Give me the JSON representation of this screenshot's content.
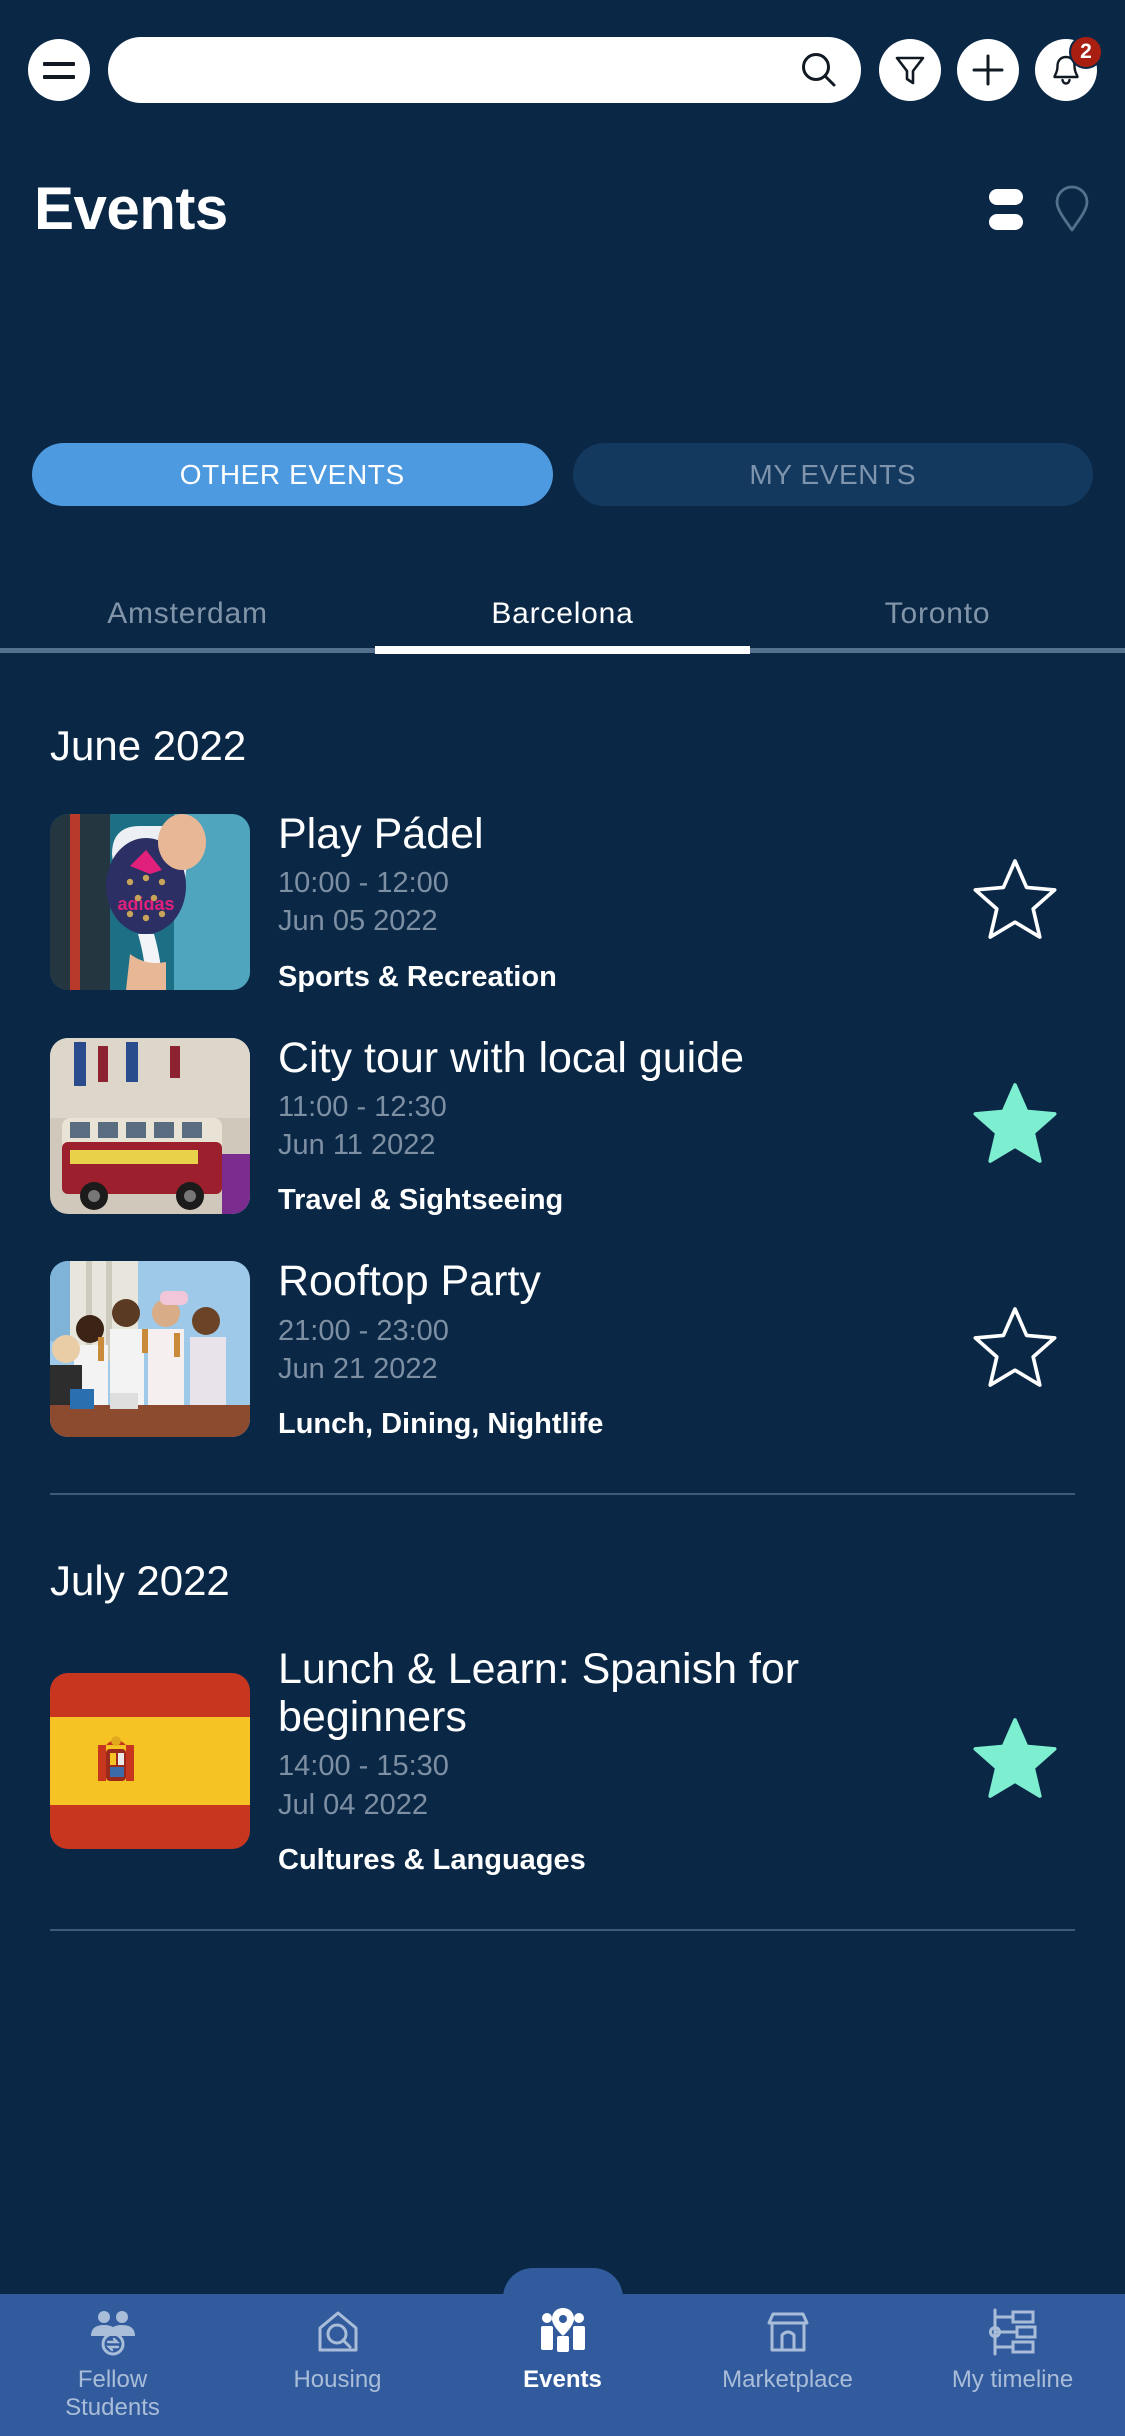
{
  "theme": {
    "background": "#0a2846",
    "accent_blue": "#4d9ae0",
    "nav_bar": "#325b9e",
    "star_filled": "#7eeed0",
    "badge_red": "#a81f12",
    "muted_text": "#7d8fa3"
  },
  "topbar": {
    "menu_label": "Menu",
    "search_placeholder": "",
    "search_value": "",
    "search_icon": "search-icon",
    "filter_icon": "filter-funnel-icon",
    "add_icon": "plus-icon",
    "notification_icon": "bell-icon",
    "notification_count": "2"
  },
  "header": {
    "title": "Events",
    "list_view_icon": "list-view-icon",
    "map_view_icon": "map-pin-icon"
  },
  "segments": [
    {
      "label": "OTHER EVENTS",
      "active": true
    },
    {
      "label": "MY EVENTS",
      "active": false
    }
  ],
  "city_tabs": [
    {
      "label": "Amsterdam",
      "active": false
    },
    {
      "label": "Barcelona",
      "active": true
    },
    {
      "label": "Toronto",
      "active": false
    }
  ],
  "sections": [
    {
      "month": "June 2022",
      "events": [
        {
          "title": "Play Pádel",
          "time": "10:00 - 12:00",
          "date": "Jun 05 2022",
          "category": "Sports & Recreation",
          "thumbnail": "padel-racket-photo",
          "favorited": false
        },
        {
          "title": "City tour with local guide",
          "time": "11:00 - 12:30",
          "date": "Jun 11 2022",
          "category": "Travel & Sightseeing",
          "thumbnail": "tour-bus-photo",
          "favorited": true
        },
        {
          "title": "Rooftop Party",
          "time": "21:00 - 23:00",
          "date": "Jun 21 2022",
          "category": "Lunch, Dining, Nightlife",
          "thumbnail": "rooftop-party-photo",
          "favorited": false
        }
      ]
    },
    {
      "month": "July 2022",
      "events": [
        {
          "title": "Lunch & Learn: Spanish for beginners",
          "time": "14:00 - 15:30",
          "date": "Jul 04 2022",
          "category": "Cultures & Languages",
          "thumbnail": "spain-flag",
          "favorited": true
        }
      ]
    }
  ],
  "bottom_nav": [
    {
      "label": "Fellow\nStudents",
      "icon": "fellow-students-icon",
      "active": false
    },
    {
      "label": "Housing",
      "icon": "housing-icon",
      "active": false
    },
    {
      "label": "Events",
      "icon": "events-icon",
      "active": true
    },
    {
      "label": "Marketplace",
      "icon": "marketplace-icon",
      "active": false
    },
    {
      "label": "My timeline",
      "icon": "my-timeline-icon",
      "active": false
    }
  ]
}
